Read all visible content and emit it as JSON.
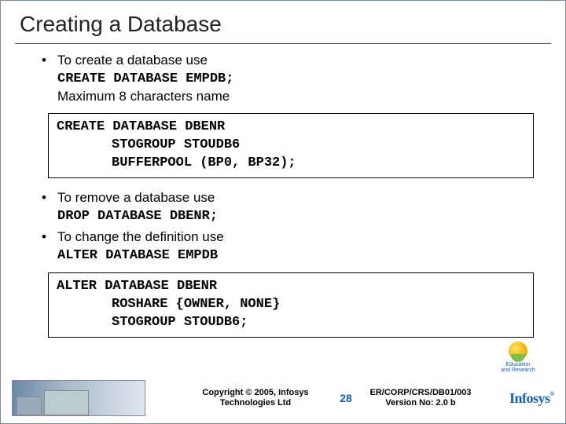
{
  "title": "Creating a Database",
  "bullets": {
    "b1_line1": "To create a database use",
    "b1_code": "CREATE DATABASE EMPDB;",
    "b1_line2": "Maximum 8 characters name",
    "b2_line1": "To remove a database use",
    "b2_code": "DROP DATABASE DBENR;",
    "b3_line1": "To change the definition use",
    "b3_code": "ALTER DATABASE EMPDB"
  },
  "codebox1": {
    "l1": "CREATE DATABASE DBENR",
    "l2": "STOGROUP STOUDB6",
    "l3": "BUFFERPOOL (BP0, BP32);"
  },
  "codebox2": {
    "l1": "ALTER DATABASE DBENR",
    "l2": "ROSHARE {OWNER, NONE}",
    "l3": "STOGROUP STOUDB6;"
  },
  "footer": {
    "copyright_l1": "Copyright © 2005, Infosys",
    "copyright_l2": "Technologies Ltd",
    "page": "28",
    "ref_l1": "ER/CORP/CRS/DB01/003",
    "ref_l2": "Version No: 2.0 b",
    "logo_text": "Infosys",
    "badge_l1": "Education",
    "badge_l2": "and Research"
  }
}
